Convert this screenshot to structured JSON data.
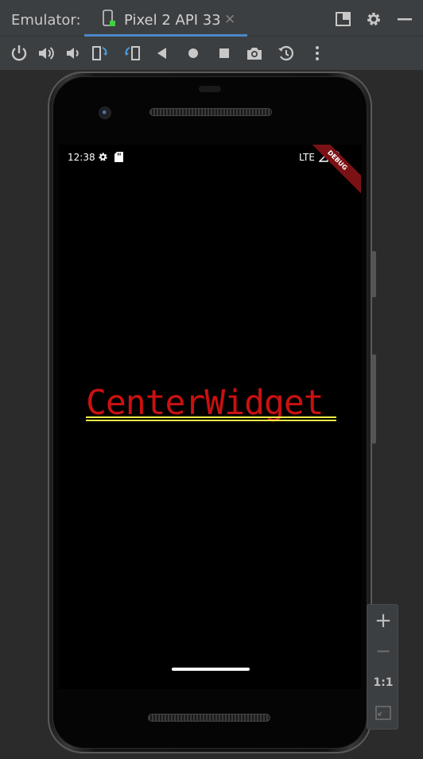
{
  "header": {
    "emulator_label": "Emulator:",
    "device_tab_label": "Pixel 2 API 33",
    "close_glyph": "×"
  },
  "toolbar": {
    "buttons": [
      "power-icon",
      "volume-up-icon",
      "volume-down-icon",
      "rotate-left-icon",
      "rotate-right-icon",
      "back-icon",
      "home-icon",
      "overview-icon",
      "screenshot-icon",
      "snapshot-icon",
      "more-icon"
    ]
  },
  "status_bar": {
    "time": "12:38",
    "network": "LTE",
    "debug_banner": "DEBUG"
  },
  "app": {
    "center_text": "CenterWidget",
    "text_color": "#cc1010",
    "decoration_color": "#f2ef46"
  },
  "zoom": {
    "zoom_in": "+",
    "zoom_out": "−",
    "actual_size": "1:1"
  },
  "colors": {
    "accent": "#4a88c7",
    "tab_status_dot": "#3fcf3f"
  }
}
